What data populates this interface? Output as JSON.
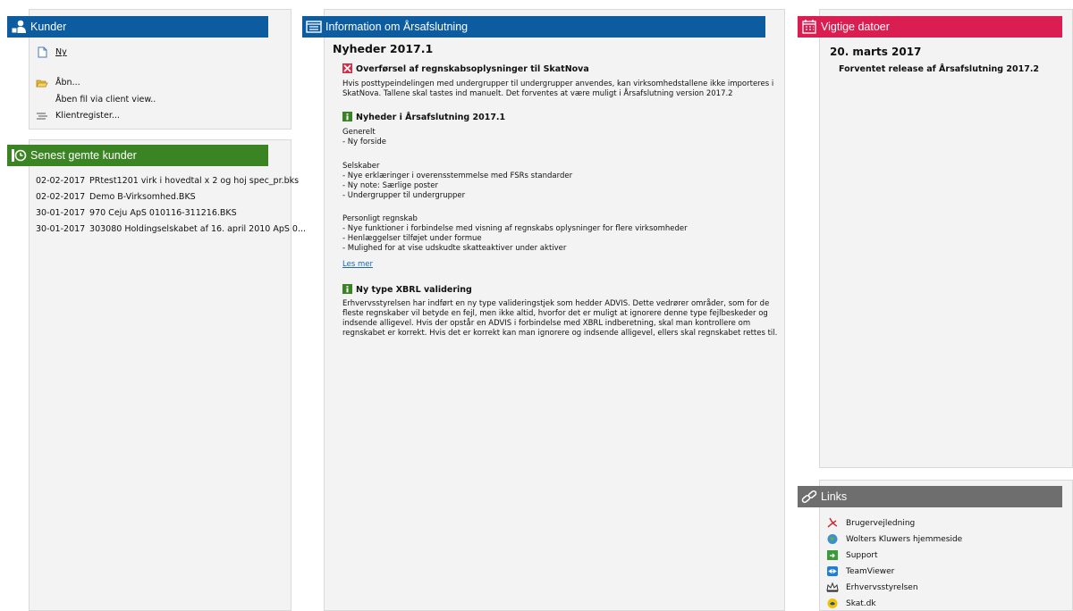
{
  "kunder": {
    "title": "Kunder",
    "ny": "Ny",
    "aabn": "Åbn...",
    "aabn_client_view": "Åben fil via client view..",
    "klientregister": "Klientregister..."
  },
  "recent": {
    "title": "Senest gemte kunder",
    "rows": [
      {
        "date": "02-02-2017",
        "name": "PRtest1201 virk i hovedtal x 2 og hoj spec_pr.bks"
      },
      {
        "date": "02-02-2017",
        "name": "Demo B-Virksomhed.BKS"
      },
      {
        "date": "30-01-2017",
        "name": "970 Ceju ApS 010116-311216.BKS"
      },
      {
        "date": "30-01-2017",
        "name": "303080 Holdingselskabet af 16. april 2010 ApS 0..."
      }
    ]
  },
  "info": {
    "title": "Information om Årsafslutning",
    "heading": "Nyheder 2017.1",
    "s1_title": "Overførsel af regnskabsoplysninger til SkatNova",
    "s1_text": "Hvis posttypeindelingen med undergrupper til undergrupper anvendes, kan virksomhedstallene ikke importeres i SkatNova. Tallene skal tastes ind manuelt. Det forventes at være muligt i Årsafslutning version 2017.2",
    "s2_title": "Nyheder i Årsafslutning 2017.1",
    "s2_generelt_head": "Generelt",
    "s2_generelt_1": "- Ny forside",
    "s2_selskaber_head": "Selskaber",
    "s2_selskaber_1": "- Nye erklæringer i overensstemmelse med FSRs standarder",
    "s2_selskaber_2": "- Ny note: Særlige poster",
    "s2_selskaber_3": "- Undergrupper til undergrupper",
    "s2_personligt_head": "Personligt regnskab",
    "s2_personligt_1": "- Nye funktioner i forbindelse med visning af regnskabs oplysninger for flere virksomheder",
    "s2_personligt_2": "- Henlæggelser tilføjet under formue",
    "s2_personligt_3": "- Mulighed for at vise udskudte skatteaktiver under aktiver",
    "les_mer": "Les mer",
    "s3_title": "Ny type XBRL validering",
    "s3_text": "Erhvervsstyrelsen har indført en ny type valideringstjek som hedder ADVIS. Dette vedrører områder, som for de fleste regnskaber vil betyde en fejl, men ikke altid, hvorfor det er muligt at ignorere denne type fejlbeskeder og indsende alligevel. Hvis der opstår en ADVIS i forbindelse med XBRL indberetning, skal man kontrollere om regnskabet er korrekt. Hvis det er korrekt kan man ignorere og indsende alligevel, ellers skal regnskabet rettes til."
  },
  "dates": {
    "title": "Vigtige datoer",
    "date": "20. marts 2017",
    "text": "Forventet release af Årsafslutning 2017.2"
  },
  "links": {
    "title": "Links",
    "items": [
      {
        "label": "Brugervejledning",
        "icon": "pdf-icon"
      },
      {
        "label": "Wolters Kluwers hjemmeside",
        "icon": "globe-icon"
      },
      {
        "label": "Support",
        "icon": "support-icon"
      },
      {
        "label": "TeamViewer",
        "icon": "teamviewer-icon"
      },
      {
        "label": "Erhvervsstyrelsen",
        "icon": "crown-icon"
      },
      {
        "label": "Skat.dk",
        "icon": "skat-icon"
      }
    ]
  },
  "colors": {
    "blue": "#0c5c9f",
    "green": "#3b8424",
    "red": "#db1e51",
    "gray": "#6e6e6e"
  }
}
